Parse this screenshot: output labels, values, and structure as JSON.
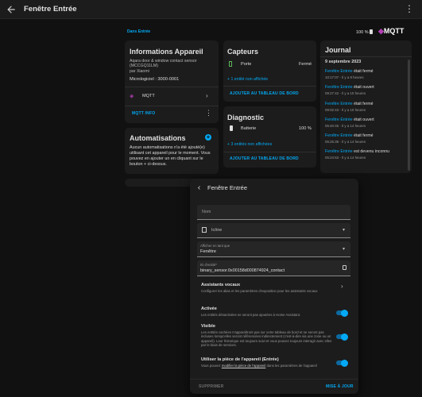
{
  "app": {
    "title": "Fenêtre Entrée"
  },
  "breadcrumb": "Dans Entrée",
  "header": {
    "battery": "100 %",
    "mqtt_logo": "MQTT"
  },
  "device_info": {
    "title": "Informations Appareil",
    "model": "Aqara door & window contact sensor (MCCGQ11LM)",
    "manufacturer": "par Xiaomi",
    "firmware": "Micrologiciel : 3000-0001",
    "integration": "MQTT",
    "action": "MQTT INFO"
  },
  "automations": {
    "title": "Automatisations",
    "text": "Aucun automatisations n'a été ajouté(e) utilisant cet appareil pour le moment. Vous pouvez en ajouter un en cliquant sur le bouton + ci-dessus."
  },
  "sensors": {
    "title": "Capteurs",
    "rows": [
      {
        "name": "Porte",
        "state": "Fermé"
      }
    ],
    "hidden_link": "+ 1 entité non affichée",
    "add_button": "AJOUTER AU TABLEAU DE BORD"
  },
  "diagnostic": {
    "title": "Diagnostic",
    "rows": [
      {
        "name": "Batterie",
        "state": "100 %"
      }
    ],
    "hidden_link": "+ 3 entités non affichées",
    "add_button": "AJOUTER AU TABLEAU DE BORD"
  },
  "journal": {
    "title": "Journal",
    "date": "9 septembre 2023",
    "entries": [
      {
        "entity": "Fenêtre Entrée",
        "event": "était fermé",
        "time": "10:17:07 - Il y a 9 heures"
      },
      {
        "entity": "Fenêtre Entrée",
        "event": "était ouvert",
        "time": "09:27:42 - Il y a 10 heures"
      },
      {
        "entity": "Fenêtre Entrée",
        "event": "était fermé",
        "time": "09:02:43 - Il y a 10 heures"
      },
      {
        "entity": "Fenêtre Entrée",
        "event": "était ouvert",
        "time": "05:40:45 - Il y a 14 heures"
      },
      {
        "entity": "Fenêtre Entrée",
        "event": "était fermé",
        "time": "05:25:35 - Il y a 14 heures"
      },
      {
        "entity": "Fenêtre Entrée",
        "event": "est devenu inconnu",
        "time": "05:24:53 - Il y a 14 heures"
      }
    ]
  },
  "dialog": {
    "title": "Fenêtre Entrée",
    "name_label": "Nom",
    "icon_label": "Icône",
    "show_as_label": "Afficher en tant que",
    "show_as_value": "Fenêtre",
    "entity_id_label": "ID d'entité*",
    "entity_id_value": "binary_sensor.0x00158d000874924_contact",
    "voice_title": "Assistants vocaux",
    "voice_desc": "Configurer les alias et les paramètres d'exposition pour les assistants vocaux",
    "enabled_title": "Activée",
    "enabled_desc": "Les entités désactivées ne seront pas ajoutées à Home Assistant.",
    "visible_title": "Visible",
    "visible_desc": "Les entités cachées n'apparaîtront pas sur votre tableau de bord et ne seront pas incluses lorsqu'elles seront référencées indirectement (c'est-à-dire via une zone ou un appareil). Leur historique est toujours suivi et vous pouvez toujours interagir avec elles par le biais de services.",
    "area_title": "Utiliser la pièce de l'appareil (Entrée)",
    "area_desc_prefix": "Vous pouvez",
    "area_desc_link": "modifier la pièce de l'appareil",
    "area_desc_suffix": "dans les paramètres de l'appareil",
    "delete_button": "SUPPRIMER",
    "update_button": "MISE À JOUR"
  },
  "colors": {
    "accent": "#03a9f4",
    "mqtt": "#b13fb3",
    "sensor_green": "#5fb65a"
  }
}
